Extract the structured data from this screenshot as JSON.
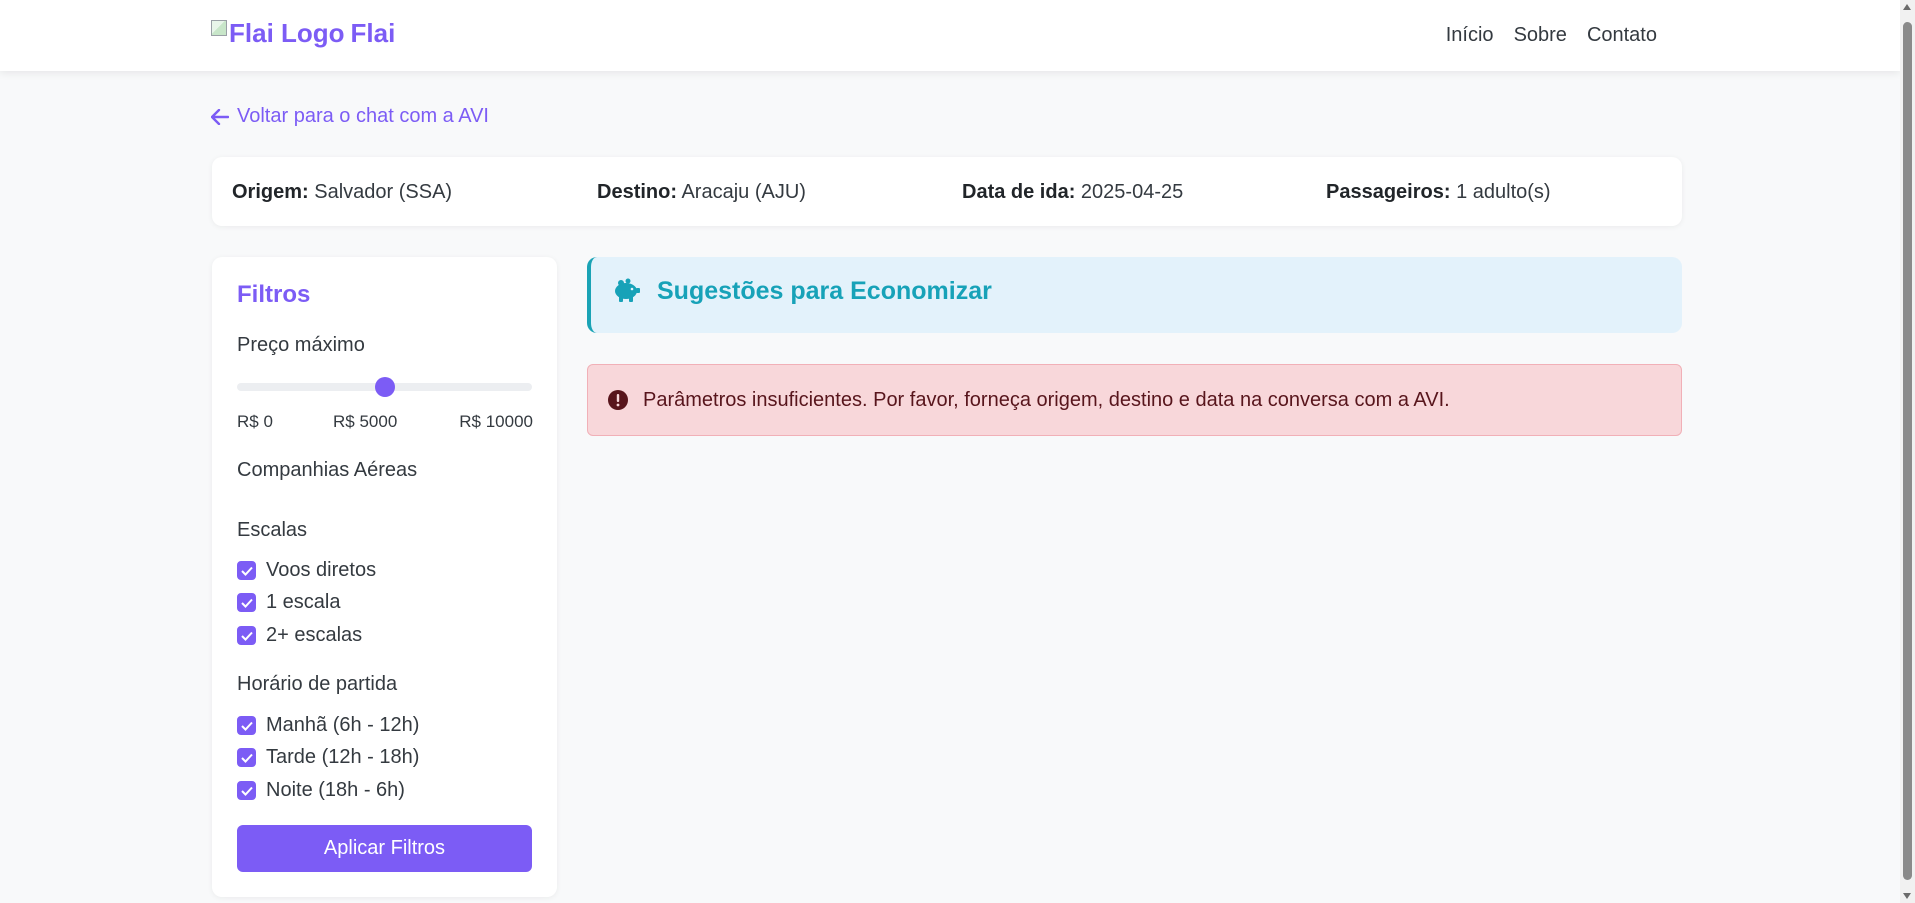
{
  "colors": {
    "brand": "#7c5cf5",
    "tips_accent": "#17a2b8",
    "alert_bg": "#f8d7da",
    "alert_text": "#58151c"
  },
  "navbar": {
    "logo_alt": "Flai Logo",
    "brand_name": "Flai",
    "links": [
      "Início",
      "Sobre",
      "Contato"
    ]
  },
  "back_link": {
    "label": "Voltar para o chat com a AVI",
    "icon": "arrow-left-icon"
  },
  "summary": {
    "origin_label": "Origem:",
    "origin_value": "Salvador (SSA)",
    "destination_label": "Destino:",
    "destination_value": "Aracaju (AJU)",
    "date_label": "Data de ida:",
    "date_value": "2025-04-25",
    "passengers_label": "Passageiros:",
    "passengers_value": "1 adulto(s)"
  },
  "filters": {
    "title": "Filtros",
    "max_price": {
      "label": "Preço máximo",
      "min_label": "R$ 0",
      "mid_label": "R$ 5000",
      "max_label": "R$ 10000",
      "value_fraction": 0.5
    },
    "airlines_label": "Companhias Aéreas",
    "stops": {
      "label": "Escalas",
      "options": [
        {
          "label": "Voos diretos",
          "checked": true
        },
        {
          "label": "1 escala",
          "checked": true
        },
        {
          "label": "2+ escalas",
          "checked": true
        }
      ]
    },
    "departure_time": {
      "label": "Horário de partida",
      "options": [
        {
          "label": "Manhã (6h - 12h)",
          "checked": true
        },
        {
          "label": "Tarde (12h - 18h)",
          "checked": true
        },
        {
          "label": "Noite (18h - 6h)",
          "checked": true
        }
      ]
    },
    "apply_button": "Aplicar Filtros"
  },
  "tips": {
    "title": "Sugestões para Economizar",
    "icon": "piggy-bank-icon"
  },
  "alert": {
    "icon": "exclamation-circle-icon",
    "message": "Parâmetros insuficientes. Por favor, forneça origem, destino e data na conversa com a AVI."
  }
}
